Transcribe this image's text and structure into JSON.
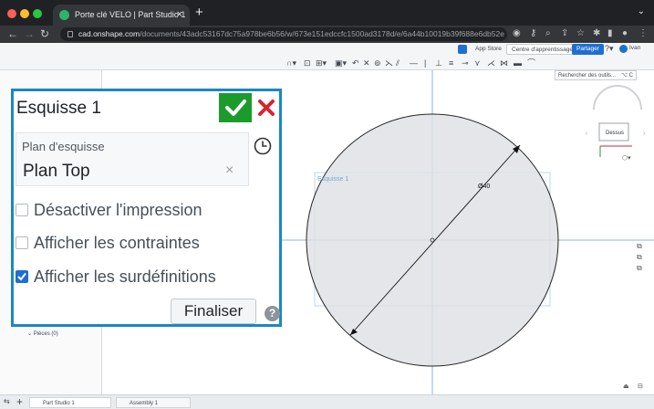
{
  "browser": {
    "tab_title": "Porte clé VELO | Part Studio 1",
    "tab_close": "×",
    "new_tab": "+",
    "url_host": "cad.onshape.com",
    "url_path": "/documents/43adc53167dc75a978be6b56/w/673e151edccfc1500ad3178d/e/6a44b10019b39f688e6db52e"
  },
  "topbar": {
    "app_store": "App Store",
    "learning_center": "Centre d'apprentissage",
    "share": "Partager",
    "user": "Ivan",
    "search_tools": "Rechercher des outils...",
    "search_shortcut": "⌥ C"
  },
  "dialog": {
    "title": "Esquisse 1",
    "plane_label": "Plan d'esquisse",
    "plane_value": "Plan Top",
    "plane_clear": "×",
    "options": [
      {
        "label": "Désactiver l'impression",
        "checked": false
      },
      {
        "label": "Afficher les contraintes",
        "checked": false
      },
      {
        "label": "Afficher les surdéfinitions",
        "checked": true
      }
    ],
    "finalize": "Finaliser",
    "help": "?"
  },
  "feature_tree": {
    "parts": "Pièces (0)"
  },
  "viewport": {
    "sketch_label": "Esquisse 1",
    "dimension": "Ø40",
    "view_cube_label": "Dessus"
  },
  "bottom_tabs": {
    "part_studio": "Part Studio 1",
    "assembly": "Assembly 1"
  },
  "colors": {
    "accent": "#1a87c4",
    "confirm": "#1c9b2d",
    "cancel": "#d9232c",
    "share_button": "#1f6fd1"
  }
}
